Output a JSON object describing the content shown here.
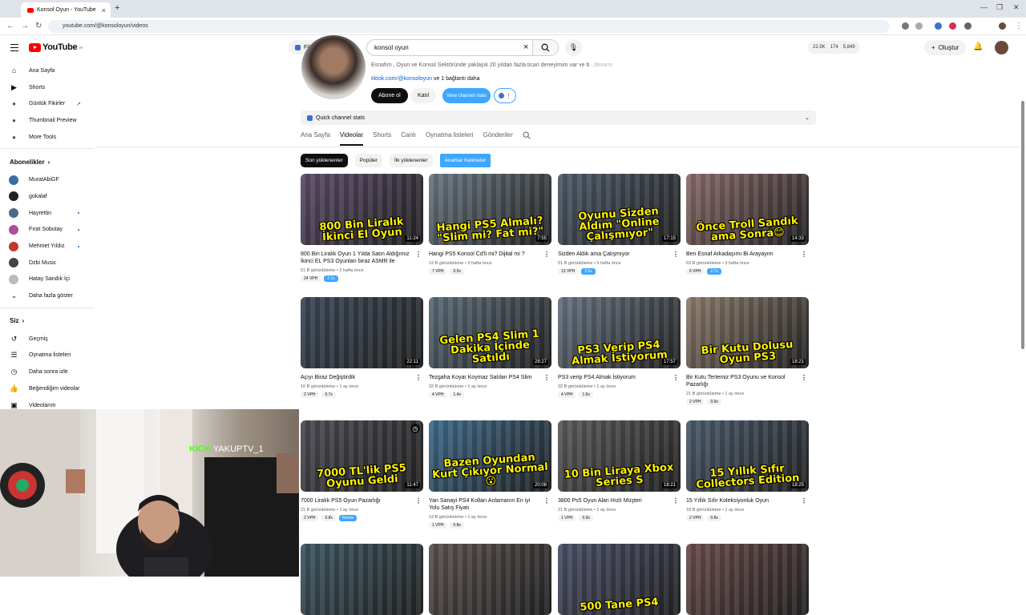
{
  "browser": {
    "tab_title": "Konsol Oyun - YouTube",
    "url": "youtube.com/@konsoloyun/videos"
  },
  "masthead": {
    "logo": "YouTube",
    "logo_country": "TR",
    "filter_label": "Filtreler",
    "search_value": "konsol oyun",
    "stats": [
      "22.5K",
      "174",
      "5,849"
    ],
    "create_label": "Oluştur"
  },
  "sidebar": {
    "top": [
      {
        "label": "Ana Sayfa",
        "icon": "home-icon"
      },
      {
        "label": "Shorts",
        "icon": "shorts-icon"
      },
      {
        "label": "Günlük Fikirler",
        "icon": "extension-icon"
      },
      {
        "label": "Thumbnail Preview",
        "icon": "extension-icon"
      },
      {
        "label": "More Tools",
        "icon": "extension-icon"
      }
    ],
    "subs_title": "Abonelikler",
    "subs": [
      {
        "label": "MuratAbiGF",
        "color": "#3a6ea5"
      },
      {
        "label": "gokalaf",
        "color": "#222222"
      },
      {
        "label": "Hayrettin",
        "color": "#4a6a8a",
        "dot": true
      },
      {
        "label": "Fırat Sobutay",
        "color": "#b04a9a",
        "dot": true
      },
      {
        "label": "Mehmet Yıldız",
        "color": "#c0392b",
        "dot": true
      },
      {
        "label": "Dzbi Music",
        "color": "#444444"
      },
      {
        "label": "Hatay Sandık İçi",
        "color": "#bbbbbb"
      }
    ],
    "show_more": "Daha fazla göster",
    "you_title": "Siz",
    "you": [
      {
        "label": "Geçmiş",
        "icon": "history-icon"
      },
      {
        "label": "Oynatma listeleri",
        "icon": "playlists-icon"
      },
      {
        "label": "Daha sonra izle",
        "icon": "clock-icon"
      },
      {
        "label": "Beğendiğim videolar",
        "icon": "thumbs-up-icon"
      },
      {
        "label": "Videolarım",
        "icon": "my-videos-icon"
      }
    ]
  },
  "channel": {
    "description": "Esnafım , Oyun ve Konsol Sektöründe yaklaşık 20 yıldan fazla ticari deneyimim var ve b",
    "description_more": "...devamı",
    "link": "tiktok.com/@konsoloyun",
    "link_more": "ve 1 bağlantı daha",
    "subscribe": "Abone ol",
    "join": "Katıl",
    "view_stats": "View channel stats",
    "quick_stats": "Quick channel stats",
    "tabs": [
      "Ana Sayfa",
      "Videolar",
      "Shorts",
      "Canlı",
      "Oynatma listeleri",
      "Gönderiler"
    ],
    "active_tab": "Videolar",
    "chips": [
      "Son yüklenenler",
      "Popüler",
      "İlk yüklenenler",
      "Anahtar Kelimeler"
    ]
  },
  "videos": [
    {
      "thumb_text": "800 Bin Liralık İkinci El Oyun",
      "duration": "11:24",
      "title": "800 Bin Liralık Oyun 1 Yılda Satın Aldığımız İkinci EL PS3 Oyunları biraz ASMR ile",
      "views": "51 B görüntüleme",
      "age": "2 hafta önce",
      "vph": "24 VPH",
      "ratio": "2.1x",
      "hot": true,
      "bg": "#5a4a66"
    },
    {
      "thumb_text": "Hangi PS5 Almalı? \"Slim mi? Fat mi?\"",
      "duration": "7:55",
      "title": "Hangi PS5 Konsol Cd'li mi? Dijital mi ?",
      "views": "12 B görüntüleme",
      "age": "3 hafta önce",
      "vph": "7 VPH",
      "ratio": "0.5x",
      "hot": false,
      "bg": "#6a7680"
    },
    {
      "thumb_text": "Oyunu Sizden Aldım \"Online Çalışmıyor\"",
      "duration": "17:15",
      "title": "Sizden Aldık ama Çalışmıyor",
      "views": "51 B görüntüleme",
      "age": "3 hafta önce",
      "vph": "13 VPH",
      "ratio": "2.5x",
      "hot": true,
      "bg": "#4e5a68"
    },
    {
      "thumb_text": "Önce Troll Sandık ama Sonra😊",
      "duration": "14:33",
      "title": "Ben Esnaf Arkadaşımı Bi Arayayım",
      "views": "63 B görüntüleme",
      "age": "3 hafta önce",
      "vph": "6 VPH",
      "ratio": "2.7x",
      "hot": true,
      "bg": "#8a6a6a"
    },
    {
      "thumb_text": "",
      "duration": "22:11",
      "title": "Açıyı Biraz Değiştirdik",
      "views": "16 B görüntüleme",
      "age": "1 ay önce",
      "vph": "2 VPH",
      "ratio": "0.7x",
      "hot": false,
      "bg": "#3a4656"
    },
    {
      "thumb_text": "Gelen PS4 Slim 1 Dakika İçinde Satıldı",
      "duration": "28:27",
      "title": "Tezgaha Koyar Koymaz Satılan PS4 Slim",
      "views": "32 B görüntüleme",
      "age": "1 ay önce",
      "vph": "4 VPH",
      "ratio": "1.4x",
      "hot": false,
      "bg": "#5a6a76"
    },
    {
      "thumb_text": "PS3 Verip PS4 Almak İstiyorum",
      "duration": "17:57",
      "title": "PS3 verip PS4 Almak İstiyorum",
      "views": "32 B görüntüleme",
      "age": "1 ay önce",
      "vph": "4 VPH",
      "ratio": "1.6x",
      "hot": false,
      "bg": "#667280"
    },
    {
      "thumb_text": "Bir Kutu Dolusu Oyun PS3",
      "duration": "18:21",
      "title": "Bir Kutu Tertemiz PS3 Oyunu ve Konsol Pazarlığı",
      "views": "21 B görüntüleme",
      "age": "1 ay önce",
      "vph": "2 VPH",
      "ratio": "0.9x",
      "hot": false,
      "bg": "#8a7a6a"
    },
    {
      "thumb_text": "7000 TL'lik PS5 Oyunu Geldi",
      "duration": "11:47",
      "title": "7000 Liralık PS5 Oyun Pazarlığı",
      "views": "21 B görüntüleme",
      "age": "1 ay önce",
      "vph": "2 VPH",
      "ratio": "0.8x",
      "remix": "Remix",
      "hot": false,
      "bg": "#4a4a52"
    },
    {
      "thumb_text": "Bazen Oyundan Kurt Çıkıyor Normal😮",
      "duration": "20:08",
      "title": "Yan Sanayi PS4 Kolları Anlamanın En iyi Yolu Satış Fiyatı",
      "views": "19 B görüntüleme",
      "age": "1 ay önce",
      "vph": "1 VPH",
      "ratio": "0.8x",
      "hot": false,
      "bg": "#3e6a8a"
    },
    {
      "thumb_text": "10 Bin Liraya Xbox Series S",
      "duration": "18:21",
      "title": "3800 Ps5 Oyun Alan Hızlı Müşteri",
      "views": "21 B görüntüleme",
      "age": "1 ay önce",
      "vph": "1 VPH",
      "ratio": "0.9x",
      "hot": false,
      "bg": "#5a5a5a"
    },
    {
      "thumb_text": "15 Yıllık Sıfır Collectors Edition",
      "duration": "18:25",
      "title": "15 Yıllık Sıfır Koleksiyonluk Oyun",
      "views": "18 B görüntüleme",
      "age": "1 ay önce",
      "vph": "2 VPH",
      "ratio": "0.8x",
      "hot": false,
      "bg": "#4a5a6a"
    },
    {
      "thumb_text": "",
      "duration": "",
      "title": "",
      "views": "",
      "age": "",
      "vph": "",
      "ratio": "",
      "hot": false,
      "bg": "#3c5660"
    },
    {
      "thumb_text": "",
      "duration": "",
      "title": "",
      "views": "",
      "age": "",
      "vph": "",
      "ratio": "",
      "hot": false,
      "bg": "#5a5050"
    },
    {
      "thumb_text": "500 Tane PS4",
      "duration": "",
      "title": "",
      "views": "",
      "age": "",
      "vph": "",
      "ratio": "",
      "hot": false,
      "bg": "#4a4e66"
    },
    {
      "thumb_text": "",
      "duration": "",
      "title": "",
      "views": "",
      "age": "",
      "vph": "",
      "ratio": "",
      "hot": false,
      "bg": "#6a4a4a"
    }
  ],
  "overlay": {
    "kick_brand": "KICK",
    "kick_user": "YAKUPTV_1"
  }
}
